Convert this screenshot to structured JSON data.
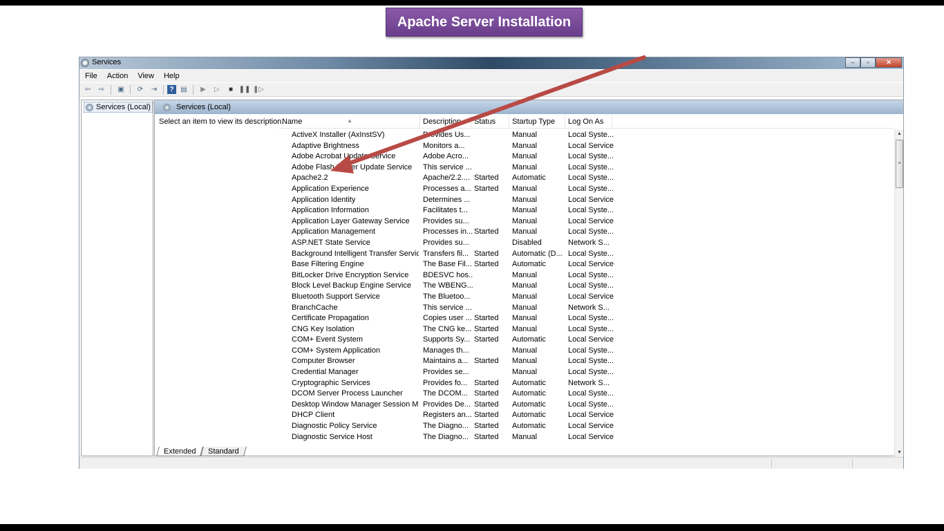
{
  "banner": {
    "title": "Apache Server Installation"
  },
  "window": {
    "title": "Services",
    "minimize": "–",
    "maximize": "▫",
    "close": "✕"
  },
  "menu": [
    "File",
    "Action",
    "View",
    "Help"
  ],
  "toolbar": {
    "icons": [
      "back-icon",
      "forward-icon",
      "show-hide-tree-icon",
      "refresh-icon",
      "export-icon",
      "help-icon",
      "properties-icon",
      "start-service-icon",
      "start-service-alt-icon",
      "stop-service-icon",
      "pause-service-icon",
      "restart-service-icon"
    ]
  },
  "tree": {
    "root_label": "Services (Local)"
  },
  "pane": {
    "header": "Services (Local)",
    "description": "Select an item to view its description."
  },
  "columns": {
    "name": "Name",
    "description": "Description",
    "status": "Status",
    "startup": "Startup Type",
    "logon": "Log On As"
  },
  "services": [
    {
      "name": "ActiveX Installer (AxInstSV)",
      "description": "Provides Us...",
      "status": "",
      "startup": "Manual",
      "logon": "Local Syste..."
    },
    {
      "name": "Adaptive Brightness",
      "description": "Monitors a...",
      "status": "",
      "startup": "Manual",
      "logon": "Local Service"
    },
    {
      "name": "Adobe Acrobat Update Service",
      "description": "Adobe Acro...",
      "status": "",
      "startup": "Manual",
      "logon": "Local Syste..."
    },
    {
      "name": "Adobe Flash Player Update Service",
      "description": "This service ...",
      "status": "",
      "startup": "Manual",
      "logon": "Local Syste..."
    },
    {
      "name": "Apache2.2",
      "description": "Apache/2.2....",
      "status": "Started",
      "startup": "Automatic",
      "logon": "Local Syste..."
    },
    {
      "name": "Application Experience",
      "description": "Processes a...",
      "status": "Started",
      "startup": "Manual",
      "logon": "Local Syste..."
    },
    {
      "name": "Application Identity",
      "description": "Determines ...",
      "status": "",
      "startup": "Manual",
      "logon": "Local Service"
    },
    {
      "name": "Application Information",
      "description": "Facilitates t...",
      "status": "",
      "startup": "Manual",
      "logon": "Local Syste..."
    },
    {
      "name": "Application Layer Gateway Service",
      "description": "Provides su...",
      "status": "",
      "startup": "Manual",
      "logon": "Local Service"
    },
    {
      "name": "Application Management",
      "description": "Processes in...",
      "status": "Started",
      "startup": "Manual",
      "logon": "Local Syste..."
    },
    {
      "name": "ASP.NET State Service",
      "description": "Provides su...",
      "status": "",
      "startup": "Disabled",
      "logon": "Network S..."
    },
    {
      "name": "Background Intelligent Transfer Service",
      "description": "Transfers fil...",
      "status": "Started",
      "startup": "Automatic (D...",
      "logon": "Local Syste..."
    },
    {
      "name": "Base Filtering Engine",
      "description": "The Base Fil...",
      "status": "Started",
      "startup": "Automatic",
      "logon": "Local Service"
    },
    {
      "name": "BitLocker Drive Encryption Service",
      "description": "BDESVC hos...",
      "status": "",
      "startup": "Manual",
      "logon": "Local Syste..."
    },
    {
      "name": "Block Level Backup Engine Service",
      "description": "The WBENG...",
      "status": "",
      "startup": "Manual",
      "logon": "Local Syste..."
    },
    {
      "name": "Bluetooth Support Service",
      "description": "The Bluetoo...",
      "status": "",
      "startup": "Manual",
      "logon": "Local Service"
    },
    {
      "name": "BranchCache",
      "description": "This service ...",
      "status": "",
      "startup": "Manual",
      "logon": "Network S..."
    },
    {
      "name": "Certificate Propagation",
      "description": "Copies user ...",
      "status": "Started",
      "startup": "Manual",
      "logon": "Local Syste..."
    },
    {
      "name": "CNG Key Isolation",
      "description": "The CNG ke...",
      "status": "Started",
      "startup": "Manual",
      "logon": "Local Syste..."
    },
    {
      "name": "COM+ Event System",
      "description": "Supports Sy...",
      "status": "Started",
      "startup": "Automatic",
      "logon": "Local Service"
    },
    {
      "name": "COM+ System Application",
      "description": "Manages th...",
      "status": "",
      "startup": "Manual",
      "logon": "Local Syste..."
    },
    {
      "name": "Computer Browser",
      "description": "Maintains a...",
      "status": "Started",
      "startup": "Manual",
      "logon": "Local Syste..."
    },
    {
      "name": "Credential Manager",
      "description": "Provides se...",
      "status": "",
      "startup": "Manual",
      "logon": "Local Syste..."
    },
    {
      "name": "Cryptographic Services",
      "description": "Provides fo...",
      "status": "Started",
      "startup": "Automatic",
      "logon": "Network S..."
    },
    {
      "name": "DCOM Server Process Launcher",
      "description": "The DCOM...",
      "status": "Started",
      "startup": "Automatic",
      "logon": "Local Syste..."
    },
    {
      "name": "Desktop Window Manager Session M...",
      "description": "Provides De...",
      "status": "Started",
      "startup": "Automatic",
      "logon": "Local Syste..."
    },
    {
      "name": "DHCP Client",
      "description": "Registers an...",
      "status": "Started",
      "startup": "Automatic",
      "logon": "Local Service"
    },
    {
      "name": "Diagnostic Policy Service",
      "description": "The Diagno...",
      "status": "Started",
      "startup": "Automatic",
      "logon": "Local Service"
    },
    {
      "name": "Diagnostic Service Host",
      "description": "The Diagno...",
      "status": "Started",
      "startup": "Manual",
      "logon": "Local Service"
    }
  ],
  "tabs": {
    "extended": "Extended",
    "standard": "Standard"
  },
  "colors": {
    "banner": "#7a4b9c",
    "arrow": "#b84a45",
    "pane_header": "#a9bfd6"
  }
}
